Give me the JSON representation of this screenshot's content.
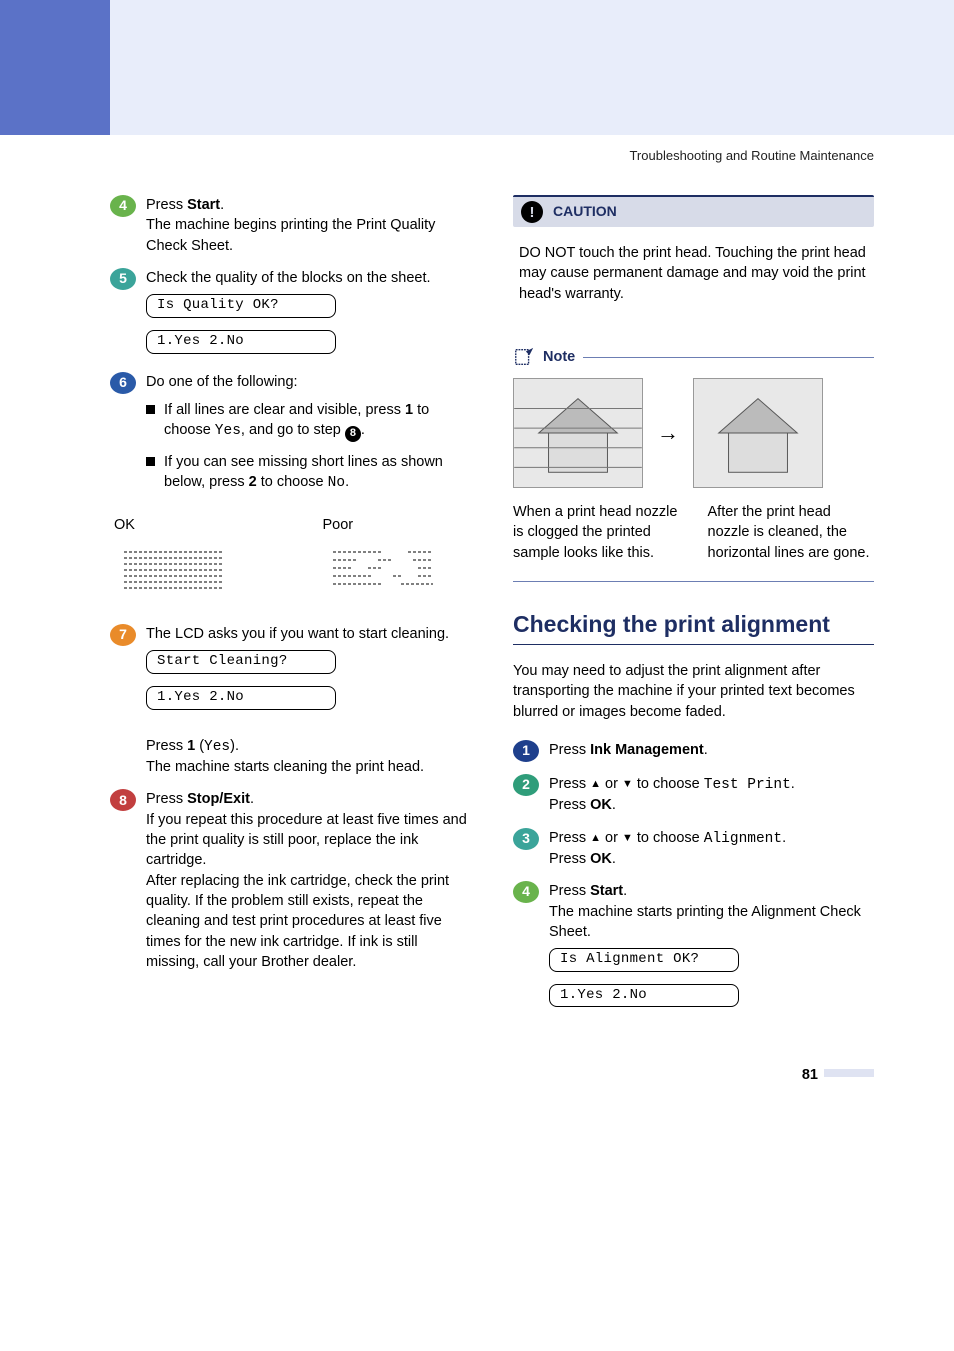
{
  "breadcrumb": "Troubleshooting and Routine Maintenance",
  "left": {
    "step4": {
      "num": "4",
      "l1a": "Press ",
      "l1b": "Start",
      "l1c": ".",
      "l2": "The machine begins printing the Print Quality Check Sheet."
    },
    "step5": {
      "num": "5",
      "l1": "Check the quality of the blocks on the sheet.",
      "lcd1": "Is Quality OK?",
      "lcd2": "1.Yes 2.No"
    },
    "step6": {
      "num": "6",
      "intro": "Do one of the following:",
      "b1a": "If all lines are clear and visible, press ",
      "b1b": "1",
      "b1c": " to choose ",
      "b1d": "Yes",
      "b1e": ", and go to step ",
      "b1ref": "8",
      "b1f": ".",
      "b2a": "If you can see missing short lines as shown below, press ",
      "b2b": "2",
      "b2c": " to choose ",
      "b2d": "No",
      "b2e": ".",
      "ok": "OK",
      "poor": "Poor"
    },
    "step7": {
      "num": "7",
      "l1": "The LCD asks you if you want to start cleaning.",
      "lcd1": "Start Cleaning?",
      "lcd2": "1.Yes 2.No",
      "l2a": "Press ",
      "l2b": "1",
      "l2c": " (",
      "l2d": "Yes",
      "l2e": ").",
      "l3": "The machine starts cleaning the print head."
    },
    "step8": {
      "num": "8",
      "l1a": "Press ",
      "l1b": "Stop/Exit",
      "l1c": ".",
      "para": "If you repeat this procedure at least five times and the print quality is still poor, replace the ink cartridge.\nAfter replacing the ink cartridge, check the print quality. If the problem still exists, repeat the cleaning and test print procedures at least five times for the new ink cartridge. If ink is still missing, call your Brother dealer."
    }
  },
  "right": {
    "caution_label": "CAUTION",
    "caution_body": "DO NOT touch the print head. Touching the print head may cause permanent damage and may void the print head's warranty.",
    "note_label": "Note",
    "arrow": "→",
    "cap_left": "When a print head nozzle is clogged the printed sample looks like this.",
    "cap_right": "After the print head nozzle is cleaned, the horizontal lines are gone.",
    "section_title": "Checking the print alignment",
    "intro": "You may need to adjust the print alignment after transporting the machine if your printed text becomes blurred or images become faded.",
    "s1": {
      "num": "1",
      "a": "Press ",
      "b": "Ink Management",
      "c": "."
    },
    "s2": {
      "num": "2",
      "a": "Press ",
      "tri_up": "▲",
      "mid": " or ",
      "tri_dn": "▼",
      "b": " to choose ",
      "opt": "Test Print",
      "c": ".",
      "d": "Press ",
      "e": "OK",
      "f": "."
    },
    "s3": {
      "num": "3",
      "a": "Press ",
      "tri_up": "▲",
      "mid": " or ",
      "tri_dn": "▼",
      "b": " to choose ",
      "opt": "Alignment",
      "c": ".",
      "d": "Press ",
      "e": "OK",
      "f": "."
    },
    "s4": {
      "num": "4",
      "a": "Press ",
      "b": "Start",
      "c": ".",
      "d": "The machine starts printing the Alignment Check Sheet.",
      "lcd1": "Is Alignment OK?",
      "lcd2": "1.Yes 2.No"
    }
  },
  "page_number": "81"
}
